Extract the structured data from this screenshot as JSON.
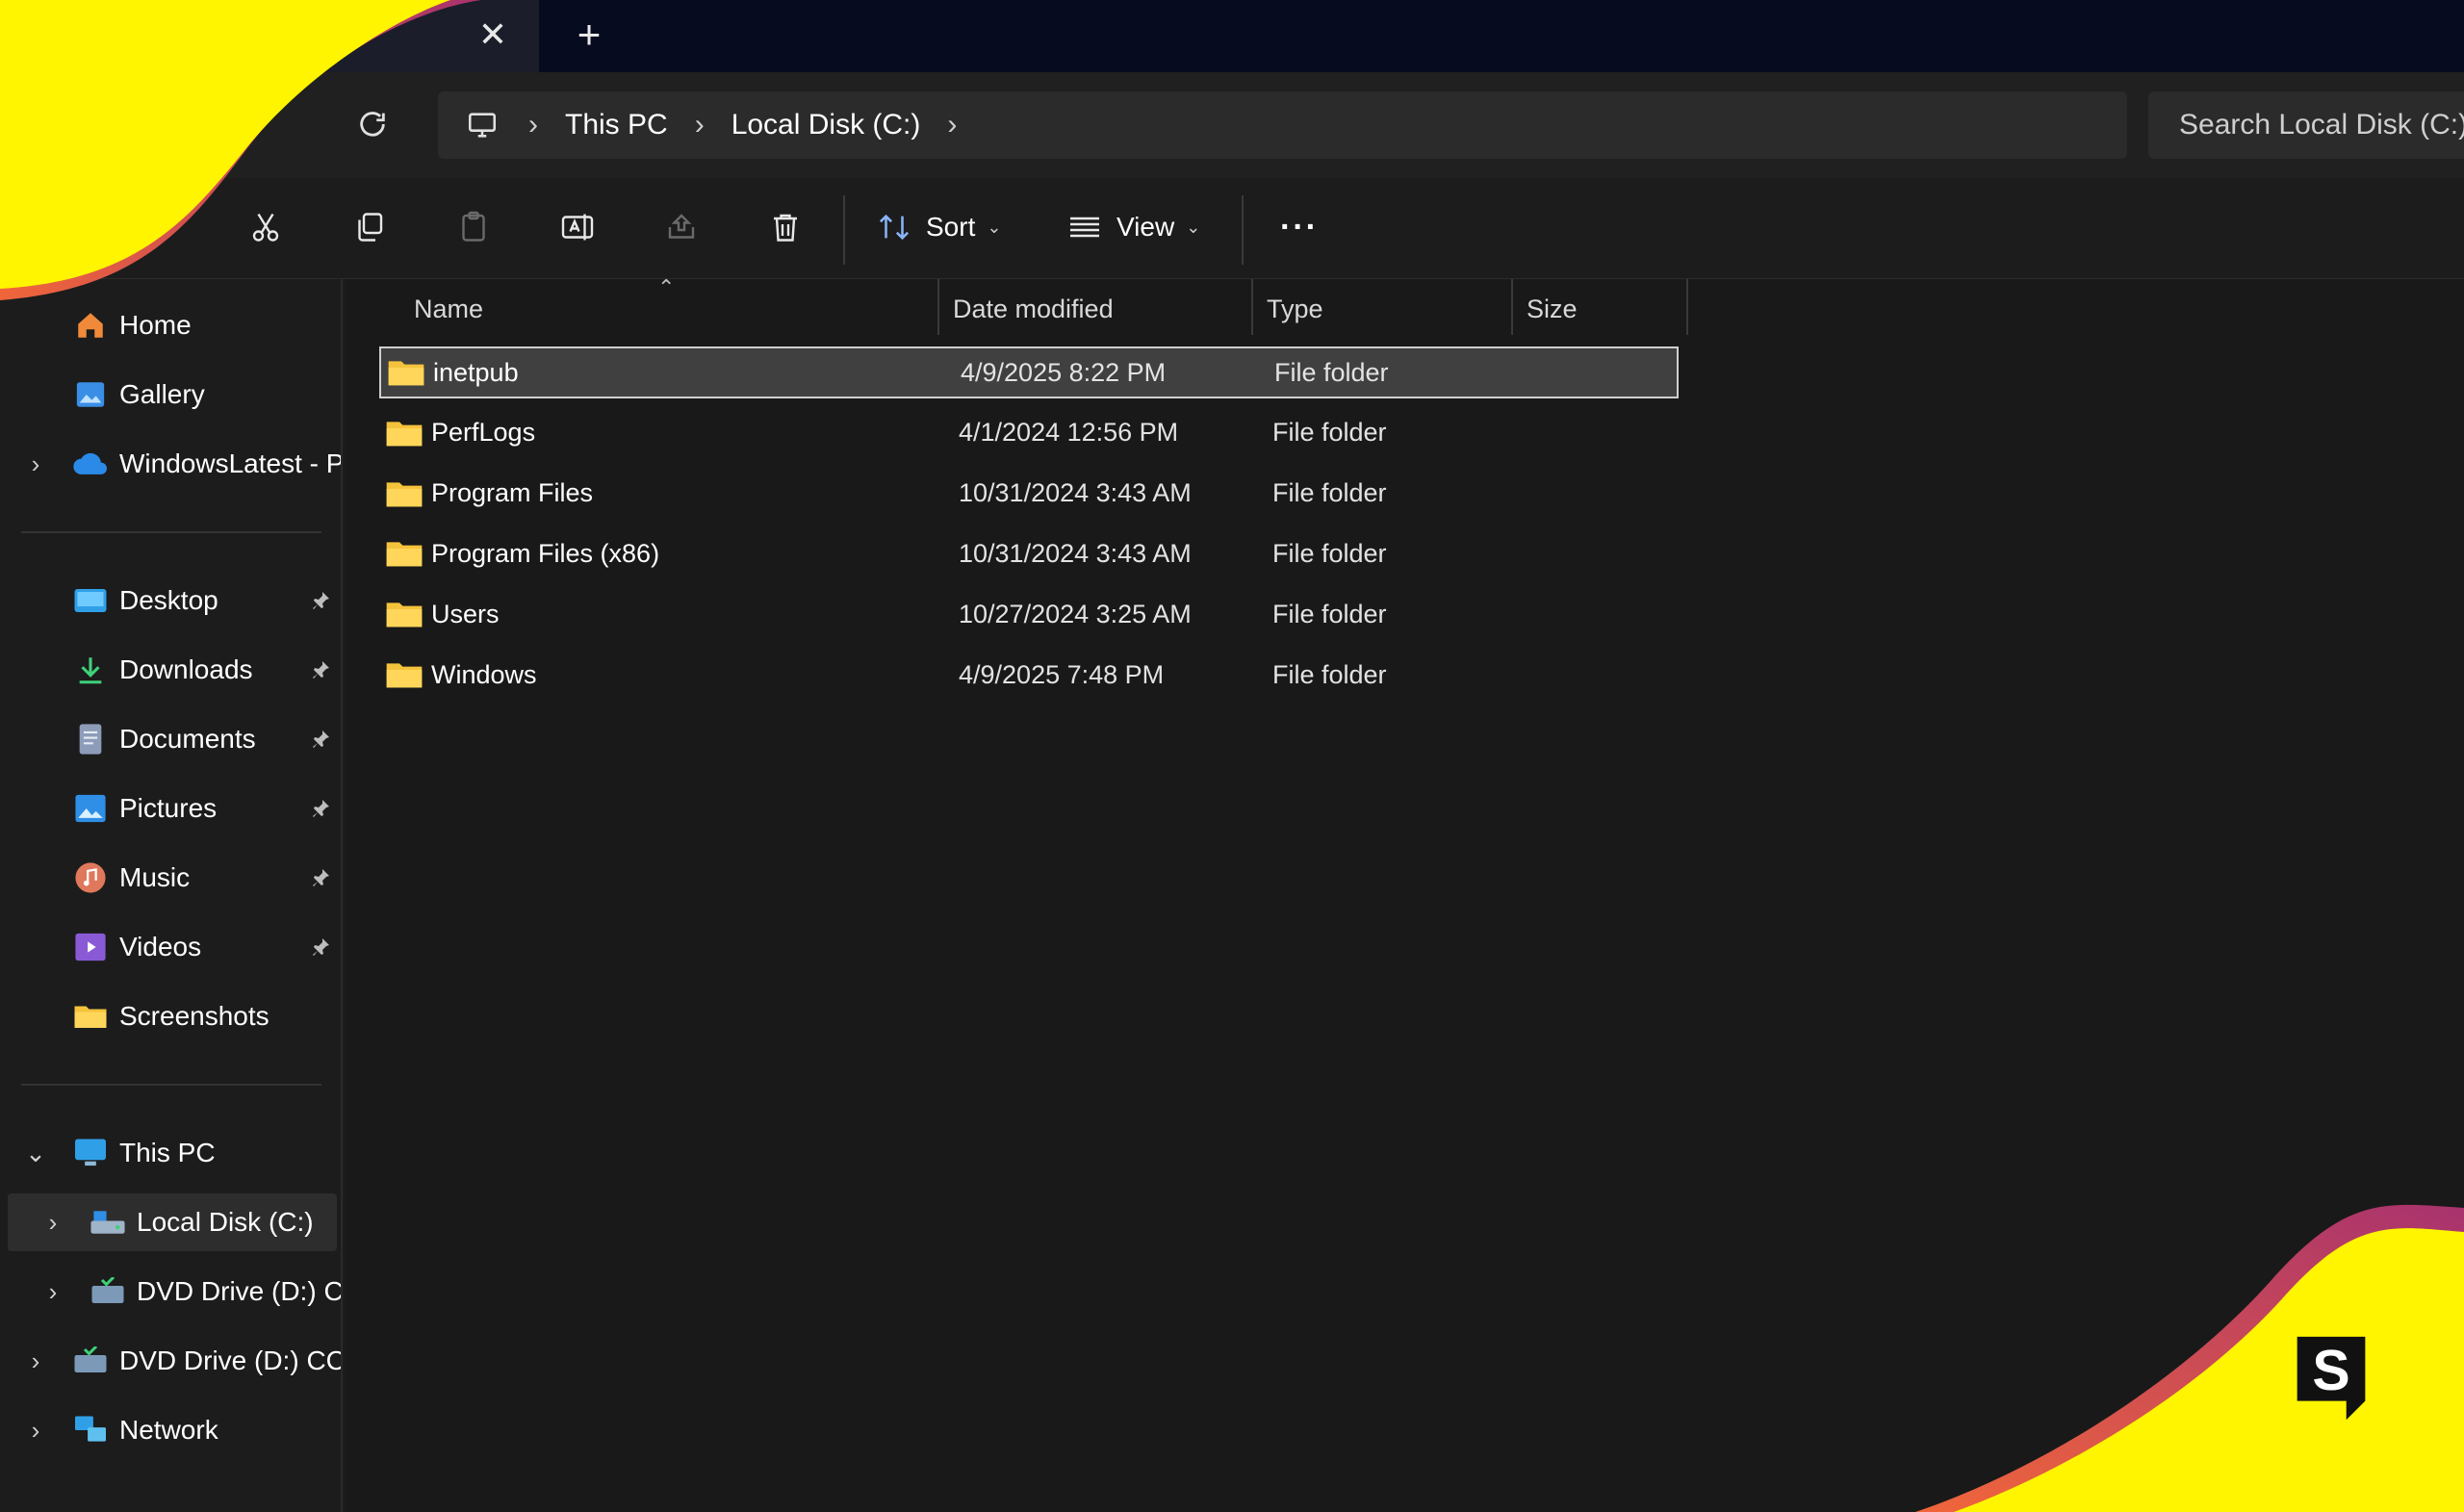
{
  "tabs": {
    "close_glyph": "✕",
    "new_tab_glyph": "+"
  },
  "address": {
    "segments": [
      "This PC",
      "Local Disk (C:)"
    ],
    "search_placeholder": "Search Local Disk (C:)"
  },
  "toolbar": {
    "sort_label": "Sort",
    "view_label": "View",
    "more_glyph": "···",
    "icons": [
      "cut-icon",
      "copy-icon",
      "paste-icon",
      "rename-icon",
      "share-icon",
      "delete-icon"
    ]
  },
  "sidebar": {
    "quick": [
      {
        "label": "Home",
        "icon": "home-icon"
      },
      {
        "label": "Gallery",
        "icon": "gallery-icon"
      },
      {
        "label": "WindowsLatest - Pe",
        "icon": "onedrive-icon",
        "expandable": true
      }
    ],
    "pinned": [
      {
        "label": "Desktop",
        "icon": "desktop-icon",
        "pinned": true
      },
      {
        "label": "Downloads",
        "icon": "downloads-icon",
        "pinned": true
      },
      {
        "label": "Documents",
        "icon": "documents-icon",
        "pinned": true
      },
      {
        "label": "Pictures",
        "icon": "pictures-icon",
        "pinned": true
      },
      {
        "label": "Music",
        "icon": "music-icon",
        "pinned": true
      },
      {
        "label": "Videos",
        "icon": "videos-icon",
        "pinned": true
      },
      {
        "label": "Screenshots",
        "icon": "folder-icon",
        "pinned": false
      }
    ],
    "this_pc": "This PC",
    "drives": [
      {
        "label": "Local Disk (C:)",
        "selected": true
      },
      {
        "label": "DVD Drive (D:) CC"
      },
      {
        "label": "DVD Drive (D:) CCC"
      }
    ],
    "network": "Network"
  },
  "columns": {
    "name": "Name",
    "date": "Date modified",
    "type": "Type",
    "size": "Size"
  },
  "files": [
    {
      "name": "inetpub",
      "date": "4/9/2025 8:22 PM",
      "type": "File folder",
      "size": "",
      "selected": true
    },
    {
      "name": "PerfLogs",
      "date": "4/1/2024 12:56 PM",
      "type": "File folder",
      "size": ""
    },
    {
      "name": "Program Files",
      "date": "10/31/2024 3:43 AM",
      "type": "File folder",
      "size": ""
    },
    {
      "name": "Program Files (x86)",
      "date": "10/31/2024 3:43 AM",
      "type": "File folder",
      "size": ""
    },
    {
      "name": "Users",
      "date": "10/27/2024 3:25 AM",
      "type": "File folder",
      "size": ""
    },
    {
      "name": "Windows",
      "date": "4/9/2025 7:48 PM",
      "type": "File folder",
      "size": ""
    }
  ],
  "colors": {
    "accent_yellow": "#fff500",
    "bg_dark": "#1c1c1c",
    "selection": "#404040"
  }
}
